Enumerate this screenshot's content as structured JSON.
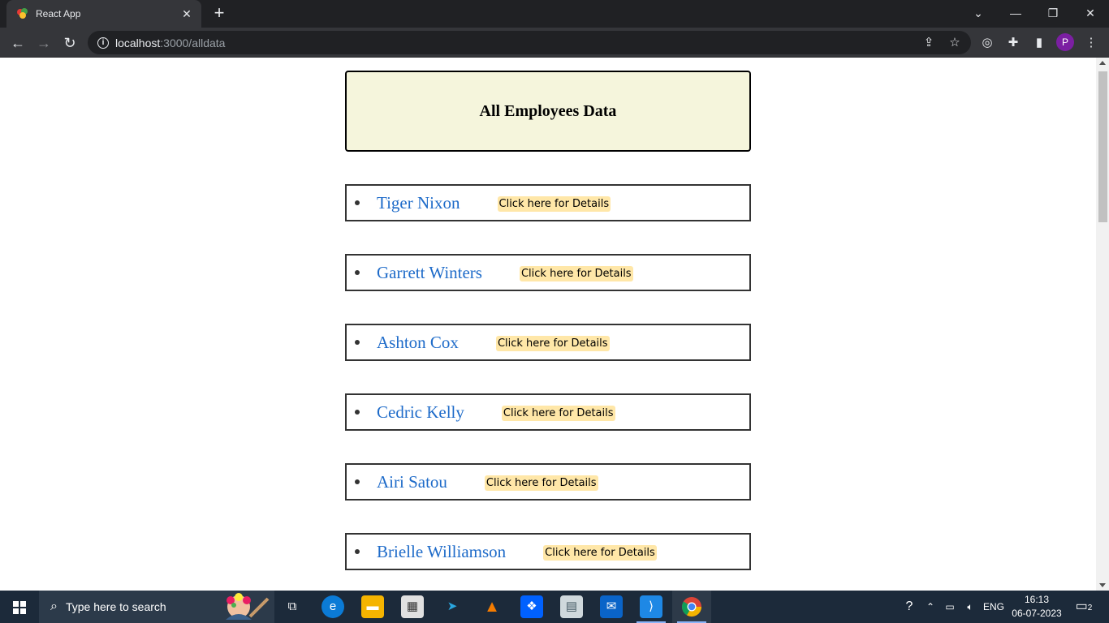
{
  "browser": {
    "tab_title": "React App",
    "url_host": "localhost",
    "url_path": ":3000/alldata",
    "profile_initial": "P"
  },
  "page": {
    "heading": "All Employees Data",
    "details_button_label": "Click here for Details",
    "employees": [
      {
        "name": "Tiger Nixon"
      },
      {
        "name": "Garrett Winters"
      },
      {
        "name": "Ashton Cox"
      },
      {
        "name": "Cedric Kelly"
      },
      {
        "name": "Airi Satou"
      },
      {
        "name": "Brielle Williamson"
      }
    ]
  },
  "taskbar": {
    "search_placeholder": "Type here to search",
    "language": "ENG",
    "time": "16:13",
    "date": "06-07-2023",
    "notification_count": "2"
  },
  "colors": {
    "header_bg": "#f5f5dc",
    "name_link": "#1e6bc9",
    "details_button_bg": "#ffe7a8"
  }
}
